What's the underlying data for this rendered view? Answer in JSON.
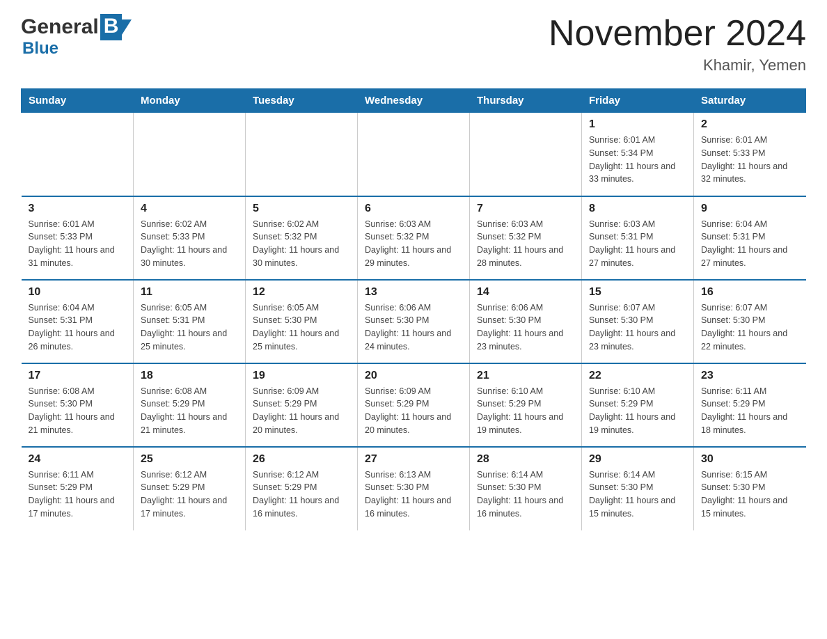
{
  "header": {
    "logo_general": "General",
    "logo_blue": "Blue",
    "month_title": "November 2024",
    "location": "Khamir, Yemen"
  },
  "days_of_week": [
    "Sunday",
    "Monday",
    "Tuesday",
    "Wednesday",
    "Thursday",
    "Friday",
    "Saturday"
  ],
  "weeks": [
    [
      {
        "day": "",
        "info": ""
      },
      {
        "day": "",
        "info": ""
      },
      {
        "day": "",
        "info": ""
      },
      {
        "day": "",
        "info": ""
      },
      {
        "day": "",
        "info": ""
      },
      {
        "day": "1",
        "info": "Sunrise: 6:01 AM\nSunset: 5:34 PM\nDaylight: 11 hours and 33 minutes."
      },
      {
        "day": "2",
        "info": "Sunrise: 6:01 AM\nSunset: 5:33 PM\nDaylight: 11 hours and 32 minutes."
      }
    ],
    [
      {
        "day": "3",
        "info": "Sunrise: 6:01 AM\nSunset: 5:33 PM\nDaylight: 11 hours and 31 minutes."
      },
      {
        "day": "4",
        "info": "Sunrise: 6:02 AM\nSunset: 5:33 PM\nDaylight: 11 hours and 30 minutes."
      },
      {
        "day": "5",
        "info": "Sunrise: 6:02 AM\nSunset: 5:32 PM\nDaylight: 11 hours and 30 minutes."
      },
      {
        "day": "6",
        "info": "Sunrise: 6:03 AM\nSunset: 5:32 PM\nDaylight: 11 hours and 29 minutes."
      },
      {
        "day": "7",
        "info": "Sunrise: 6:03 AM\nSunset: 5:32 PM\nDaylight: 11 hours and 28 minutes."
      },
      {
        "day": "8",
        "info": "Sunrise: 6:03 AM\nSunset: 5:31 PM\nDaylight: 11 hours and 27 minutes."
      },
      {
        "day": "9",
        "info": "Sunrise: 6:04 AM\nSunset: 5:31 PM\nDaylight: 11 hours and 27 minutes."
      }
    ],
    [
      {
        "day": "10",
        "info": "Sunrise: 6:04 AM\nSunset: 5:31 PM\nDaylight: 11 hours and 26 minutes."
      },
      {
        "day": "11",
        "info": "Sunrise: 6:05 AM\nSunset: 5:31 PM\nDaylight: 11 hours and 25 minutes."
      },
      {
        "day": "12",
        "info": "Sunrise: 6:05 AM\nSunset: 5:30 PM\nDaylight: 11 hours and 25 minutes."
      },
      {
        "day": "13",
        "info": "Sunrise: 6:06 AM\nSunset: 5:30 PM\nDaylight: 11 hours and 24 minutes."
      },
      {
        "day": "14",
        "info": "Sunrise: 6:06 AM\nSunset: 5:30 PM\nDaylight: 11 hours and 23 minutes."
      },
      {
        "day": "15",
        "info": "Sunrise: 6:07 AM\nSunset: 5:30 PM\nDaylight: 11 hours and 23 minutes."
      },
      {
        "day": "16",
        "info": "Sunrise: 6:07 AM\nSunset: 5:30 PM\nDaylight: 11 hours and 22 minutes."
      }
    ],
    [
      {
        "day": "17",
        "info": "Sunrise: 6:08 AM\nSunset: 5:30 PM\nDaylight: 11 hours and 21 minutes."
      },
      {
        "day": "18",
        "info": "Sunrise: 6:08 AM\nSunset: 5:29 PM\nDaylight: 11 hours and 21 minutes."
      },
      {
        "day": "19",
        "info": "Sunrise: 6:09 AM\nSunset: 5:29 PM\nDaylight: 11 hours and 20 minutes."
      },
      {
        "day": "20",
        "info": "Sunrise: 6:09 AM\nSunset: 5:29 PM\nDaylight: 11 hours and 20 minutes."
      },
      {
        "day": "21",
        "info": "Sunrise: 6:10 AM\nSunset: 5:29 PM\nDaylight: 11 hours and 19 minutes."
      },
      {
        "day": "22",
        "info": "Sunrise: 6:10 AM\nSunset: 5:29 PM\nDaylight: 11 hours and 19 minutes."
      },
      {
        "day": "23",
        "info": "Sunrise: 6:11 AM\nSunset: 5:29 PM\nDaylight: 11 hours and 18 minutes."
      }
    ],
    [
      {
        "day": "24",
        "info": "Sunrise: 6:11 AM\nSunset: 5:29 PM\nDaylight: 11 hours and 17 minutes."
      },
      {
        "day": "25",
        "info": "Sunrise: 6:12 AM\nSunset: 5:29 PM\nDaylight: 11 hours and 17 minutes."
      },
      {
        "day": "26",
        "info": "Sunrise: 6:12 AM\nSunset: 5:29 PM\nDaylight: 11 hours and 16 minutes."
      },
      {
        "day": "27",
        "info": "Sunrise: 6:13 AM\nSunset: 5:30 PM\nDaylight: 11 hours and 16 minutes."
      },
      {
        "day": "28",
        "info": "Sunrise: 6:14 AM\nSunset: 5:30 PM\nDaylight: 11 hours and 16 minutes."
      },
      {
        "day": "29",
        "info": "Sunrise: 6:14 AM\nSunset: 5:30 PM\nDaylight: 11 hours and 15 minutes."
      },
      {
        "day": "30",
        "info": "Sunrise: 6:15 AM\nSunset: 5:30 PM\nDaylight: 11 hours and 15 minutes."
      }
    ]
  ]
}
